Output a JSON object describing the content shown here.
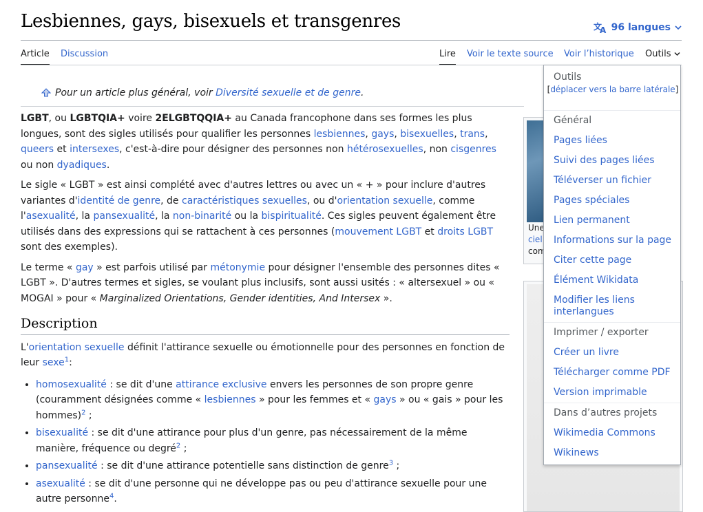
{
  "page": {
    "title": "Lesbiennes, gays, bisexuels et transgenres",
    "languages": "96 langues"
  },
  "tabs": {
    "article": "Article",
    "discussion": "Discussion",
    "read": "Lire",
    "source": "Voir le texte source",
    "history": "Voir l’historique",
    "tools": "Outils"
  },
  "hatnote": {
    "text": "Pour un article plus général, voir ",
    "link": "Diversité sexuelle et de genre",
    "end": "."
  },
  "para1": {
    "b1": "LGBT",
    "t1": ", ou ",
    "b2": "LGBTQIA+",
    "t2": " voire ",
    "b3": "2ELGBTQQIA+",
    "t3": " au Canada francophone dans ses formes les plus longues, sont des sigles utilisés pour qualifier les personnes ",
    "l1": "lesbiennes",
    "c1": ", ",
    "l2": "gays",
    "c2": ", ",
    "l3": "bisexuelles",
    "c3": ", ",
    "l4": "trans",
    "c4": ", ",
    "l5": "queers",
    "t4": " et ",
    "l6": "intersexes",
    "t5": ", c'est-à-dire pour désigner des personnes non ",
    "l7": "hétérosexuelles",
    "t6": ", non ",
    "l8": "cisgenres",
    "t7": " ou non ",
    "l9": "dyadiques",
    "t8": "."
  },
  "para2": {
    "t1": "Le sigle « LGBT » est ainsi complété avec d'autres lettres ou avec un « + » pour inclure d'autres variantes d'",
    "l1": "identité de genre",
    "t2": ", de ",
    "l2": "caractéristiques sexuelles",
    "t3": ", ou d'",
    "l3": "orientation sexuelle",
    "t4": ", comme l'",
    "l4": "asexualité",
    "t5": ", la ",
    "l5": "pansexualité",
    "t6": ", la ",
    "l6": "non-binarité",
    "t7": " ou la ",
    "l7": "bispiritualité",
    "t8": ". Ces sigles peuvent également être utilisés dans des expressions qui se rattachent à ces personnes (",
    "l8": "mouvement LGBT",
    "t9": " et ",
    "l9": "droits LGBT",
    "t10": " sont des exemples)."
  },
  "para3": {
    "t1": "Le terme « ",
    "l1": "gay",
    "t2": " » est parfois utilisé par ",
    "l2": "métonymie",
    "t3": " pour désigner l'ensemble des personnes dites « LGBT ». D'autres termes et sigles, se voulant plus inclusifs, sont aussi usités : « altersexuel » ou « MOGAI » pour « ",
    "i1": "Marginalized Orientations, Gender identities, And Intersex",
    "t4": " »."
  },
  "section": {
    "title": "Description",
    "intro1": "L'",
    "intro_link": "orientation sexuelle",
    "intro2": " définit l'attirance sexuelle ou émotionnelle pour des personnes en fonction de leur ",
    "intro_link2": "sexe",
    "intro_ref": "1",
    "intro3": ":"
  },
  "list": [
    {
      "l1": "homosexualité",
      "t1": " : se dit d'une ",
      "l2": "attirance exclusive",
      "t2": " envers les personnes de son propre genre (couramment désignées comme « ",
      "l3": "lesbiennes",
      "t3": " » pour les femmes et « ",
      "l4": "gays",
      "t4": " » ou « gais » pour les hommes)",
      "ref": "2",
      "t5": " ;"
    },
    {
      "l1": "bisexualité",
      "t1": " : se dit d'une attirance pour plus d'un genre, pas nécessairement de la même manière, fréquence ou degré",
      "ref": "2",
      "t2": " ;"
    },
    {
      "l1": "pansexualité",
      "t1": " : se dit d'une attirance potentielle sans distinction de genre",
      "ref": "3",
      "t2": " ;"
    },
    {
      "l1": "asexualité",
      "t1": " : se dit d'une personne qui ne développe pas ou peu d'attirance sexuelle pour une autre personne",
      "ref": "4",
      "t2": "."
    }
  ],
  "infobox": {
    "cap1": "Une",
    "cap2": "ciel",
    "cap3": "com"
  },
  "tools_menu": {
    "header": "Outils",
    "move": "déplacer vers la barre latérale",
    "general": "Général",
    "general_items": [
      "Pages liées",
      "Suivi des pages liées",
      "Téléverser un fichier",
      "Pages spéciales",
      "Lien permanent",
      "Informations sur la page",
      "Citer cette page",
      "Élément Wikidata",
      "Modifier les liens interlangues"
    ],
    "print": "Imprimer / exporter",
    "print_items": [
      "Créer un livre",
      "Télécharger comme PDF",
      "Version imprimable"
    ],
    "other": "Dans d’autres projets",
    "other_items": [
      "Wikimedia Commons",
      "Wikinews"
    ]
  },
  "colors": {
    "link": "#3366cc",
    "text": "#202122",
    "border": "#a2a9b1"
  }
}
